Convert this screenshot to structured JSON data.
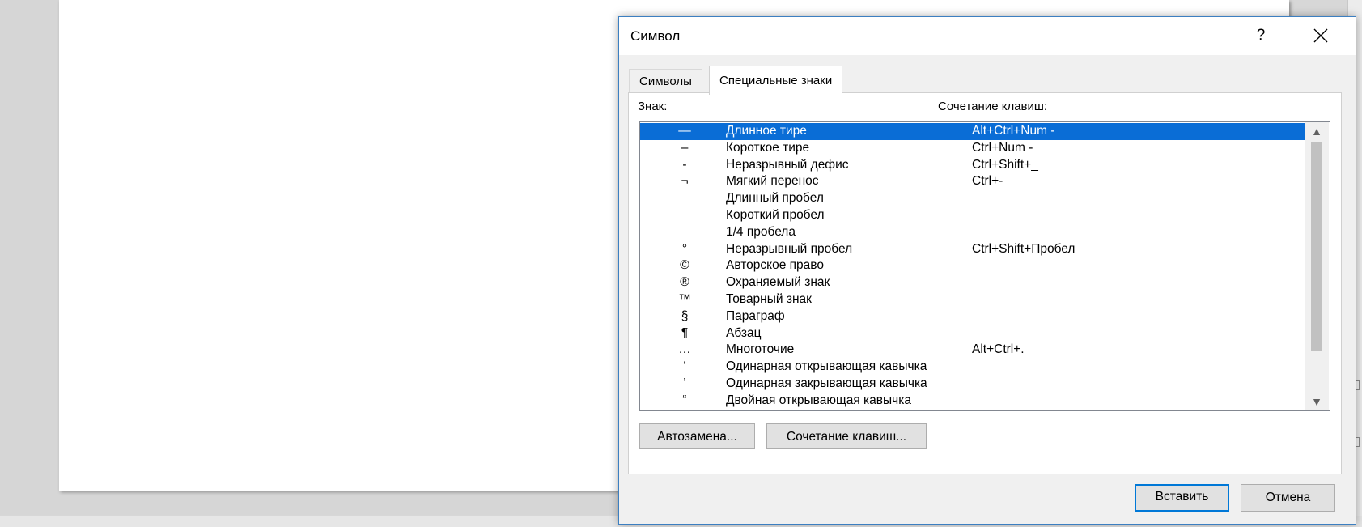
{
  "dialog": {
    "title": "Символ",
    "help_label": "?",
    "tabs": [
      {
        "label": "Символы"
      },
      {
        "label": "Специальные знаки"
      }
    ],
    "column_sign": "Знак:",
    "column_shortcut": "Сочетание клавиш:",
    "rows": [
      {
        "sym": "—",
        "name": "Длинное тире",
        "shortcut": "Alt+Ctrl+Num -"
      },
      {
        "sym": "–",
        "name": "Короткое тире",
        "shortcut": "Ctrl+Num -"
      },
      {
        "sym": "-",
        "name": "Неразрывный дефис",
        "shortcut": "Ctrl+Shift+_"
      },
      {
        "sym": "¬",
        "name": "Мягкий перенос",
        "shortcut": "Ctrl+-"
      },
      {
        "sym": "",
        "name": "Длинный пробел",
        "shortcut": ""
      },
      {
        "sym": "",
        "name": "Короткий пробел",
        "shortcut": ""
      },
      {
        "sym": "",
        "name": "1/4 пробела",
        "shortcut": ""
      },
      {
        "sym": "°",
        "name": "Неразрывный пробел",
        "shortcut": "Ctrl+Shift+Пробел"
      },
      {
        "sym": "©",
        "name": "Авторское право",
        "shortcut": ""
      },
      {
        "sym": "®",
        "name": "Охраняемый знак",
        "shortcut": ""
      },
      {
        "sym": "™",
        "name": "Товарный знак",
        "shortcut": ""
      },
      {
        "sym": "§",
        "name": "Параграф",
        "shortcut": ""
      },
      {
        "sym": "¶",
        "name": "Абзац",
        "shortcut": ""
      },
      {
        "sym": "…",
        "name": "Многоточие",
        "shortcut": "Alt+Ctrl+."
      },
      {
        "sym": "‘",
        "name": "Одинарная открывающая кавычка",
        "shortcut": ""
      },
      {
        "sym": "’",
        "name": "Одинарная закрывающая кавычка",
        "shortcut": ""
      },
      {
        "sym": "“",
        "name": "Двойная открывающая кавычка",
        "shortcut": ""
      }
    ],
    "selected_row": 0,
    "autocorrect_button": "Автозамена...",
    "shortcut_button": "Сочетание клавиш...",
    "insert_button": "Вставить",
    "cancel_button": "Отмена"
  },
  "colors": {
    "selection": "#0a6dd6",
    "accent_border": "#0078d7"
  }
}
